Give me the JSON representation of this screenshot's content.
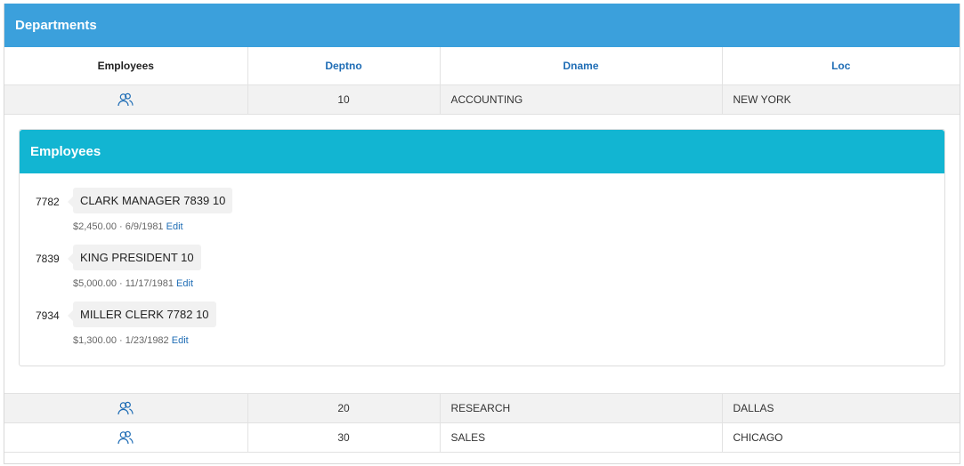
{
  "region": {
    "title": "Departments"
  },
  "columns": {
    "employees": "Employees",
    "deptno": "Deptno",
    "dname": "Dname",
    "loc": "Loc"
  },
  "departments": [
    {
      "deptno": "10",
      "dname": "ACCOUNTING",
      "loc": "NEW YORK",
      "icon": "users-icon",
      "expanded": true
    },
    {
      "deptno": "20",
      "dname": "RESEARCH",
      "loc": "DALLAS",
      "icon": "users-icon",
      "expanded": false
    },
    {
      "deptno": "30",
      "dname": "SALES",
      "loc": "CHICAGO",
      "icon": "users-icon",
      "expanded": false
    }
  ],
  "employees_panel": {
    "title": "Employees",
    "items": [
      {
        "empno": "7782",
        "summary": "CLARK MANAGER 7839 10",
        "sal": "$2,450.00",
        "sep": "·",
        "hiredate": "6/9/1981",
        "edit": "Edit"
      },
      {
        "empno": "7839",
        "summary": "KING PRESIDENT 10",
        "sal": "$5,000.00",
        "sep": "·",
        "hiredate": "11/17/1981",
        "edit": "Edit"
      },
      {
        "empno": "7934",
        "summary": "MILLER CLERK 7782 10",
        "sal": "$1,300.00",
        "sep": "·",
        "hiredate": "1/23/1982",
        "edit": "Edit"
      }
    ]
  },
  "colors": {
    "region_header": "#3ba0dc",
    "sub_header": "#12b5d2",
    "link": "#1f6db5"
  }
}
